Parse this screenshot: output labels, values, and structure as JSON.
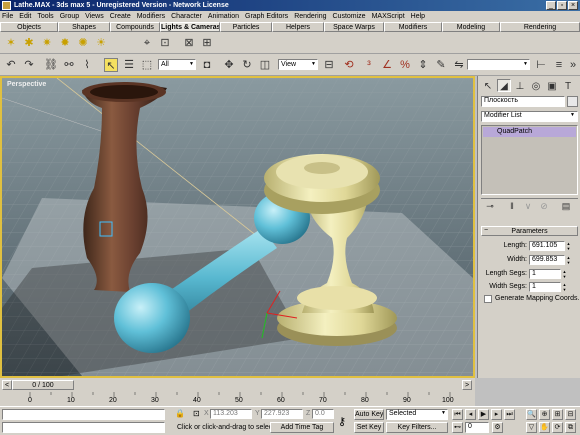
{
  "window": {
    "title": "Lathe.MAX - 3ds max 5 - Unregistered Version - Network License"
  },
  "menu": [
    "File",
    "Edit",
    "Tools",
    "Group",
    "Views",
    "Create",
    "Modifiers",
    "Character",
    "Animation",
    "Graph Editors",
    "Rendering",
    "Customize",
    "MAXScript",
    "Help"
  ],
  "tabs": [
    "Objects",
    "Shapes",
    "Compounds",
    "Lights & Cameras",
    "Particles",
    "Helpers",
    "Space Warps",
    "Modifiers",
    "Modeling",
    "Rendering"
  ],
  "active_tab": "Lights & Cameras",
  "main_toolbar": {
    "selection_filter": "All",
    "ref_coord": "View"
  },
  "viewport": {
    "label": "Perspective"
  },
  "command_panel": {
    "object_name": "Плоскость",
    "modifier_list": "Modifier List",
    "stack_item": "QuadPatch",
    "rollout": "Parameters",
    "params": [
      {
        "label": "Length:",
        "value": "691.105"
      },
      {
        "label": "Width:",
        "value": "699.853"
      },
      {
        "label": "Length Segs:",
        "value": "1"
      },
      {
        "label": "Width Segs:",
        "value": "1"
      }
    ],
    "checkbox_label": "Generate Mapping Coords."
  },
  "timeline": {
    "position": "0 / 100",
    "ticks": [
      "0",
      "10",
      "20",
      "30",
      "40",
      "50",
      "60",
      "70",
      "80",
      "90",
      "100"
    ]
  },
  "status": {
    "prompt": "Click or click-and-drag to select obj",
    "x": "113.203",
    "y": "227.923",
    "z": "0.0",
    "add_time_tag": "Add Time Tag",
    "auto_key": "Auto Key",
    "set_key": "Set Key",
    "key_mode": "Selected",
    "key_filters": "Key Filters...",
    "frame": "0"
  },
  "colors": {
    "viewport_border": "#e0c040",
    "title_bar": "#0a246a",
    "active_stack": "#b8a8d8"
  }
}
